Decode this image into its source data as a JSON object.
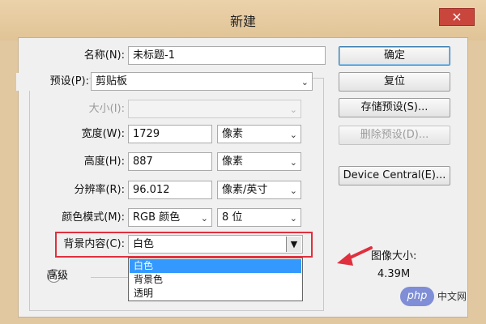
{
  "window": {
    "title": "新建",
    "close_glyph": "×"
  },
  "form": {
    "name_label": "名称(N):",
    "name_value": "未标题-1",
    "preset_label": "预设(P):",
    "preset_value": "剪贴板",
    "size_label": "大小(I):",
    "size_value": "",
    "width_label": "宽度(W):",
    "width_value": "1729",
    "width_unit": "像素",
    "height_label": "高度(H):",
    "height_value": "887",
    "height_unit": "像素",
    "resolution_label": "分辨率(R):",
    "resolution_value": "96.012",
    "resolution_unit": "像素/英寸",
    "color_mode_label": "颜色模式(M):",
    "color_mode_value": "RGB 颜色",
    "bit_depth_value": "8 位",
    "background_label": "背景内容(C):",
    "background_value": "白色",
    "advanced_label": "高级"
  },
  "background_options": [
    "白色",
    "背景色",
    "透明"
  ],
  "buttons": {
    "ok": "确定",
    "reset": "复位",
    "save_preset": "存储预设(S)...",
    "delete_preset": "删除预设(D)...",
    "device_central": "Device Central(E)..."
  },
  "image_size": {
    "label": "图像大小:",
    "value": "4.39M"
  },
  "watermark": {
    "badge": "php",
    "text": "中文网"
  },
  "colors": {
    "highlight": "#e0303e",
    "selection": "#3399ff",
    "title_bar": "#e2c8a0"
  }
}
